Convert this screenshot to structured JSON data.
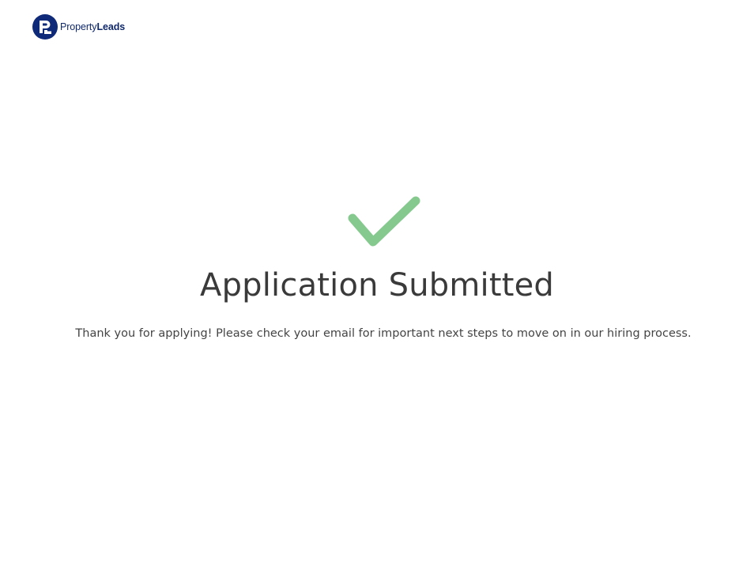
{
  "logo": {
    "name_light": "Property",
    "name_bold": "Leads",
    "brand_color": "#0e2a78"
  },
  "status": {
    "icon": "checkmark-icon",
    "icon_color": "#86c98f",
    "title": "Application Submitted",
    "message": "Thank you for applying! Please check your email for important next steps to move on in our hiring process."
  }
}
